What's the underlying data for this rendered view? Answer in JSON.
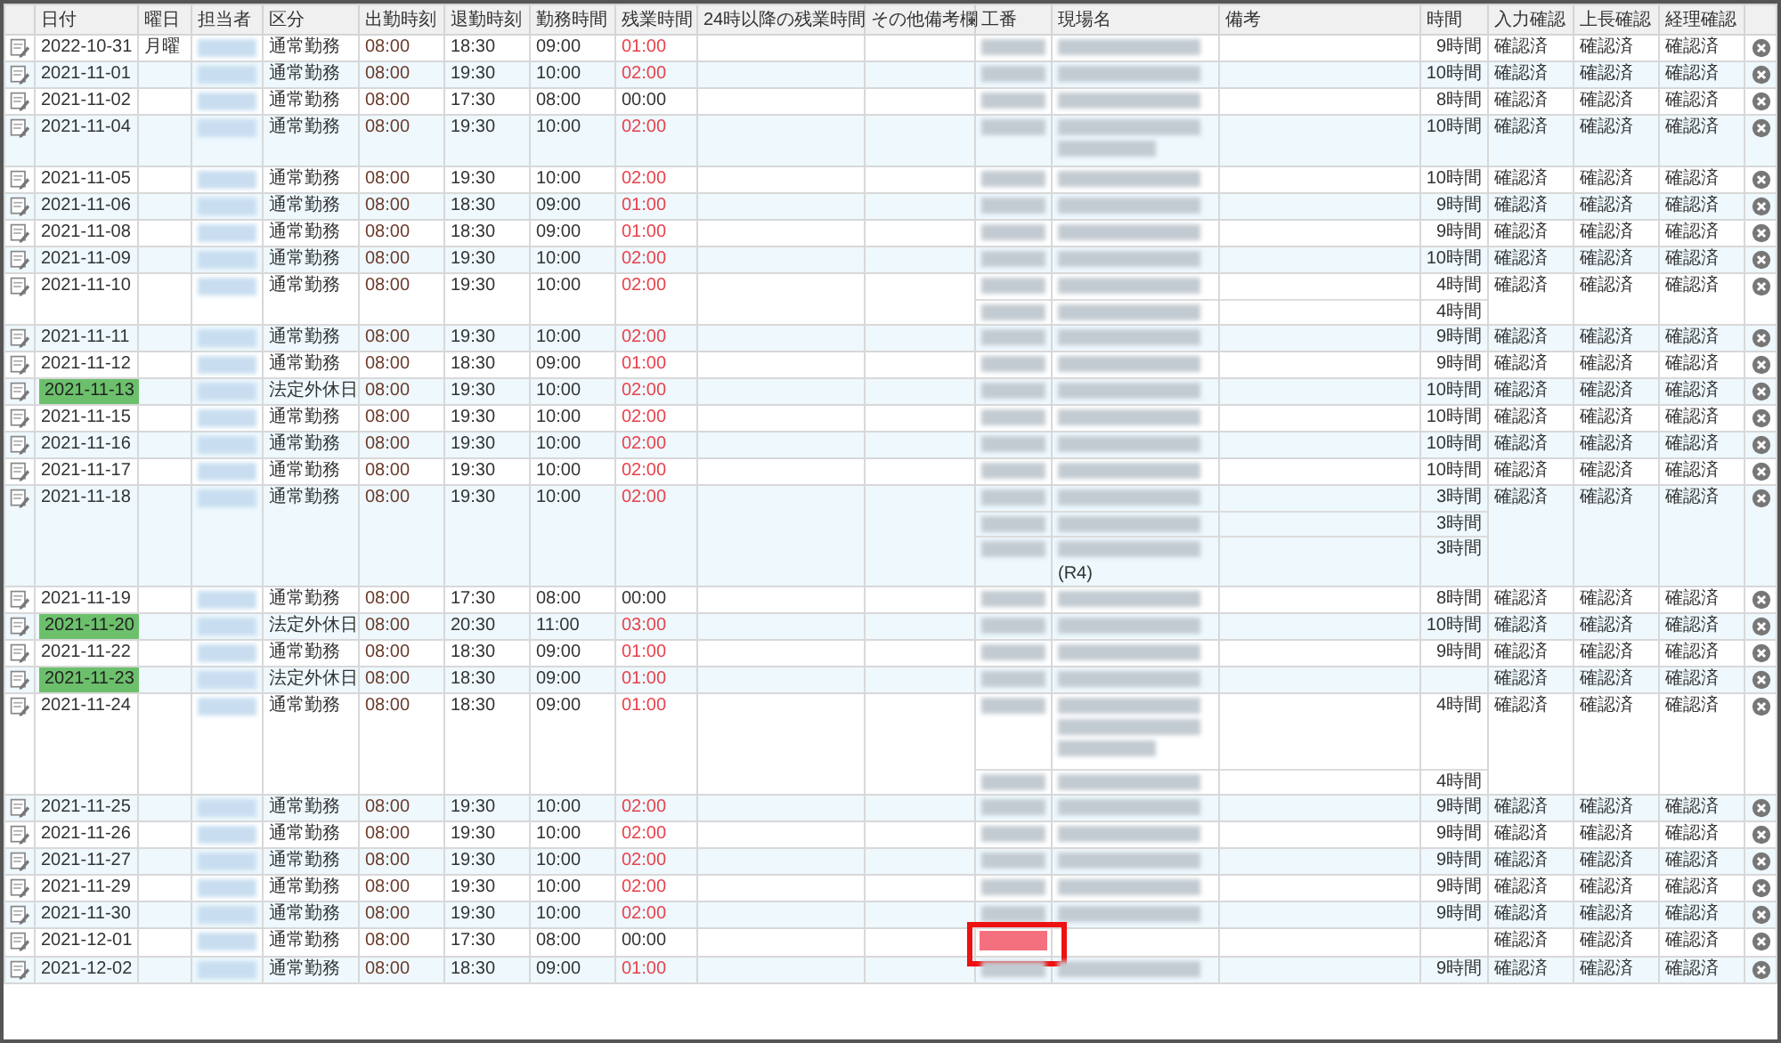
{
  "columns": [
    "日付",
    "曜日",
    "担当者",
    "区分",
    "出勤時刻",
    "退勤時刻",
    "勤務時間",
    "残業時間",
    "24時以降の残業時間",
    "その他備考欄",
    "工番",
    "現場名",
    "備考",
    "時間",
    "入力確認",
    "上長確認",
    "経理確認"
  ],
  "rows": [
    {
      "date": "2022-10-31",
      "holiday": false,
      "weekday": "月曜",
      "type": "通常勤務",
      "start": "08:00",
      "end": "18:30",
      "work": "09:00",
      "overtime": "01:00",
      "overtime_alert": true,
      "entries": [
        {
          "kind": "single",
          "hours": "9時間"
        }
      ],
      "input_check": "確認済",
      "boss_check": "確認済",
      "accounting_check": "確認済"
    },
    {
      "date": "2021-11-01",
      "holiday": false,
      "type": "通常勤務",
      "start": "08:00",
      "end": "19:30",
      "work": "10:00",
      "overtime": "02:00",
      "overtime_alert": true,
      "entries": [
        {
          "kind": "single",
          "hours": "10時間"
        }
      ],
      "input_check": "確認済",
      "boss_check": "確認済",
      "accounting_check": "確認済"
    },
    {
      "date": "2021-11-02",
      "holiday": false,
      "type": "通常勤務",
      "start": "08:00",
      "end": "17:30",
      "work": "08:00",
      "overtime": "00:00",
      "overtime_alert": false,
      "entries": [
        {
          "kind": "single",
          "hours": "8時間"
        }
      ],
      "input_check": "確認済",
      "boss_check": "確認済",
      "accounting_check": "確認済"
    },
    {
      "date": "2021-11-04",
      "holiday": false,
      "type": "通常勤務",
      "start": "08:00",
      "end": "19:30",
      "work": "10:00",
      "overtime": "02:00",
      "overtime_alert": true,
      "entries": [
        {
          "kind": "double",
          "hours": "10時間"
        }
      ],
      "input_check": "確認済",
      "boss_check": "確認済",
      "accounting_check": "確認済"
    },
    {
      "date": "2021-11-05",
      "holiday": false,
      "type": "通常勤務",
      "start": "08:00",
      "end": "19:30",
      "work": "10:00",
      "overtime": "02:00",
      "overtime_alert": true,
      "entries": [
        {
          "kind": "single",
          "hours": "10時間"
        }
      ],
      "input_check": "確認済",
      "boss_check": "確認済",
      "accounting_check": "確認済"
    },
    {
      "date": "2021-11-06",
      "holiday": false,
      "type": "通常勤務",
      "start": "08:00",
      "end": "18:30",
      "work": "09:00",
      "overtime": "01:00",
      "overtime_alert": true,
      "entries": [
        {
          "kind": "single",
          "hours": "9時間"
        }
      ],
      "input_check": "確認済",
      "boss_check": "確認済",
      "accounting_check": "確認済"
    },
    {
      "date": "2021-11-08",
      "holiday": false,
      "type": "通常勤務",
      "start": "08:00",
      "end": "18:30",
      "work": "09:00",
      "overtime": "01:00",
      "overtime_alert": true,
      "entries": [
        {
          "kind": "single",
          "hours": "9時間"
        }
      ],
      "input_check": "確認済",
      "boss_check": "確認済",
      "accounting_check": "確認済"
    },
    {
      "date": "2021-11-09",
      "holiday": false,
      "type": "通常勤務",
      "start": "08:00",
      "end": "19:30",
      "work": "10:00",
      "overtime": "02:00",
      "overtime_alert": true,
      "entries": [
        {
          "kind": "single",
          "hours": "10時間"
        }
      ],
      "input_check": "確認済",
      "boss_check": "確認済",
      "accounting_check": "確認済"
    },
    {
      "date": "2021-11-10",
      "holiday": false,
      "type": "通常勤務",
      "start": "08:00",
      "end": "19:30",
      "work": "10:00",
      "overtime": "02:00",
      "overtime_alert": true,
      "entries": [
        {
          "kind": "single",
          "hours": "4時間"
        },
        {
          "kind": "single",
          "hours": "4時間"
        }
      ],
      "input_check": "確認済",
      "boss_check": "確認済",
      "accounting_check": "確認済"
    },
    {
      "date": "2021-11-11",
      "holiday": false,
      "type": "通常勤務",
      "start": "08:00",
      "end": "19:30",
      "work": "10:00",
      "overtime": "02:00",
      "overtime_alert": true,
      "entries": [
        {
          "kind": "single",
          "hours": "9時間"
        }
      ],
      "input_check": "確認済",
      "boss_check": "確認済",
      "accounting_check": "確認済"
    },
    {
      "date": "2021-11-12",
      "holiday": false,
      "type": "通常勤務",
      "start": "08:00",
      "end": "18:30",
      "work": "09:00",
      "overtime": "01:00",
      "overtime_alert": true,
      "entries": [
        {
          "kind": "single",
          "hours": "9時間"
        }
      ],
      "input_check": "確認済",
      "boss_check": "確認済",
      "accounting_check": "確認済"
    },
    {
      "date": "2021-11-13",
      "holiday": true,
      "type": "法定外休日",
      "start": "08:00",
      "end": "19:30",
      "work": "10:00",
      "overtime": "02:00",
      "overtime_alert": true,
      "entries": [
        {
          "kind": "single",
          "hours": "10時間"
        }
      ],
      "input_check": "確認済",
      "boss_check": "確認済",
      "accounting_check": "確認済"
    },
    {
      "date": "2021-11-15",
      "holiday": false,
      "type": "通常勤務",
      "start": "08:00",
      "end": "19:30",
      "work": "10:00",
      "overtime": "02:00",
      "overtime_alert": true,
      "entries": [
        {
          "kind": "single",
          "hours": "10時間"
        }
      ],
      "input_check": "確認済",
      "boss_check": "確認済",
      "accounting_check": "確認済"
    },
    {
      "date": "2021-11-16",
      "holiday": false,
      "type": "通常勤務",
      "start": "08:00",
      "end": "19:30",
      "work": "10:00",
      "overtime": "02:00",
      "overtime_alert": true,
      "entries": [
        {
          "kind": "single",
          "hours": "10時間"
        }
      ],
      "input_check": "確認済",
      "boss_check": "確認済",
      "accounting_check": "確認済"
    },
    {
      "date": "2021-11-17",
      "holiday": false,
      "type": "通常勤務",
      "start": "08:00",
      "end": "19:30",
      "work": "10:00",
      "overtime": "02:00",
      "overtime_alert": true,
      "entries": [
        {
          "kind": "single",
          "hours": "10時間"
        }
      ],
      "input_check": "確認済",
      "boss_check": "確認済",
      "accounting_check": "確認済"
    },
    {
      "date": "2021-11-18",
      "holiday": false,
      "type": "通常勤務",
      "start": "08:00",
      "end": "19:30",
      "work": "10:00",
      "overtime": "02:00",
      "overtime_alert": true,
      "entries": [
        {
          "kind": "single",
          "hours": "3時間"
        },
        {
          "kind": "single",
          "hours": "3時間"
        },
        {
          "kind": "note",
          "hours": "3時間",
          "note": "(R4)"
        }
      ],
      "input_check": "確認済",
      "boss_check": "確認済",
      "accounting_check": "確認済"
    },
    {
      "date": "2021-11-19",
      "holiday": false,
      "type": "通常勤務",
      "start": "08:00",
      "end": "17:30",
      "work": "08:00",
      "overtime": "00:00",
      "overtime_alert": false,
      "entries": [
        {
          "kind": "single",
          "hours": "8時間"
        }
      ],
      "input_check": "確認済",
      "boss_check": "確認済",
      "accounting_check": "確認済"
    },
    {
      "date": "2021-11-20",
      "holiday": true,
      "type": "法定外休日",
      "start": "08:00",
      "end": "20:30",
      "work": "11:00",
      "overtime": "03:00",
      "overtime_alert": true,
      "entries": [
        {
          "kind": "single",
          "hours": "10時間"
        }
      ],
      "input_check": "確認済",
      "boss_check": "確認済",
      "accounting_check": "確認済"
    },
    {
      "date": "2021-11-22",
      "holiday": false,
      "type": "通常勤務",
      "start": "08:00",
      "end": "18:30",
      "work": "09:00",
      "overtime": "01:00",
      "overtime_alert": true,
      "entries": [
        {
          "kind": "single",
          "hours": "9時間"
        }
      ],
      "input_check": "確認済",
      "boss_check": "確認済",
      "accounting_check": "確認済"
    },
    {
      "date": "2021-11-23",
      "holiday": true,
      "type": "法定外休日",
      "start": "08:00",
      "end": "18:30",
      "work": "09:00",
      "overtime": "01:00",
      "overtime_alert": true,
      "entries": [
        {
          "kind": "single"
        }
      ],
      "input_check": "確認済",
      "boss_check": "確認済",
      "accounting_check": "確認済"
    },
    {
      "date": "2021-11-24",
      "holiday": false,
      "type": "通常勤務",
      "start": "08:00",
      "end": "18:30",
      "work": "09:00",
      "overtime": "01:00",
      "overtime_alert": true,
      "entries": [
        {
          "kind": "triple",
          "hours": "4時間"
        },
        {
          "kind": "single",
          "hours": "4時間"
        }
      ],
      "input_check": "確認済",
      "boss_check": "確認済",
      "accounting_check": "確認済"
    },
    {
      "date": "2021-11-25",
      "holiday": false,
      "type": "通常勤務",
      "start": "08:00",
      "end": "19:30",
      "work": "10:00",
      "overtime": "02:00",
      "overtime_alert": true,
      "entries": [
        {
          "kind": "single",
          "hours": "9時間"
        }
      ],
      "input_check": "確認済",
      "boss_check": "確認済",
      "accounting_check": "確認済"
    },
    {
      "date": "2021-11-26",
      "holiday": false,
      "type": "通常勤務",
      "start": "08:00",
      "end": "19:30",
      "work": "10:00",
      "overtime": "02:00",
      "overtime_alert": true,
      "entries": [
        {
          "kind": "single",
          "hours": "9時間"
        }
      ],
      "input_check": "確認済",
      "boss_check": "確認済",
      "accounting_check": "確認済"
    },
    {
      "date": "2021-11-27",
      "holiday": false,
      "type": "通常勤務",
      "start": "08:00",
      "end": "19:30",
      "work": "10:00",
      "overtime": "02:00",
      "overtime_alert": true,
      "entries": [
        {
          "kind": "single",
          "hours": "9時間"
        }
      ],
      "input_check": "確認済",
      "boss_check": "確認済",
      "accounting_check": "確認済"
    },
    {
      "date": "2021-11-29",
      "holiday": false,
      "type": "通常勤務",
      "start": "08:00",
      "end": "19:30",
      "work": "10:00",
      "overtime": "02:00",
      "overtime_alert": true,
      "entries": [
        {
          "kind": "single",
          "hours": "9時間"
        }
      ],
      "input_check": "確認済",
      "boss_check": "確認済",
      "accounting_check": "確認済"
    },
    {
      "date": "2021-11-30",
      "holiday": false,
      "type": "通常勤務",
      "start": "08:00",
      "end": "19:30",
      "work": "10:00",
      "overtime": "02:00",
      "overtime_alert": true,
      "entries": [
        {
          "kind": "single",
          "hours": "9時間"
        }
      ],
      "input_check": "確認済",
      "boss_check": "確認済",
      "accounting_check": "確認済"
    },
    {
      "date": "2021-12-01",
      "holiday": false,
      "type": "通常勤務",
      "start": "08:00",
      "end": "17:30",
      "work": "08:00",
      "overtime": "00:00",
      "overtime_alert": false,
      "entries": [
        {
          "kind": "marked"
        }
      ],
      "input_check": "確認済",
      "boss_check": "確認済",
      "accounting_check": "確認済"
    },
    {
      "date": "2021-12-02",
      "holiday": false,
      "type": "通常勤務",
      "start": "08:00",
      "end": "18:30",
      "work": "09:00",
      "overtime": "01:00",
      "overtime_alert": true,
      "entries": [
        {
          "kind": "single",
          "hours": "9時間"
        }
      ],
      "input_check": "確認済",
      "boss_check": "確認済",
      "accounting_check": "確認済"
    }
  ]
}
